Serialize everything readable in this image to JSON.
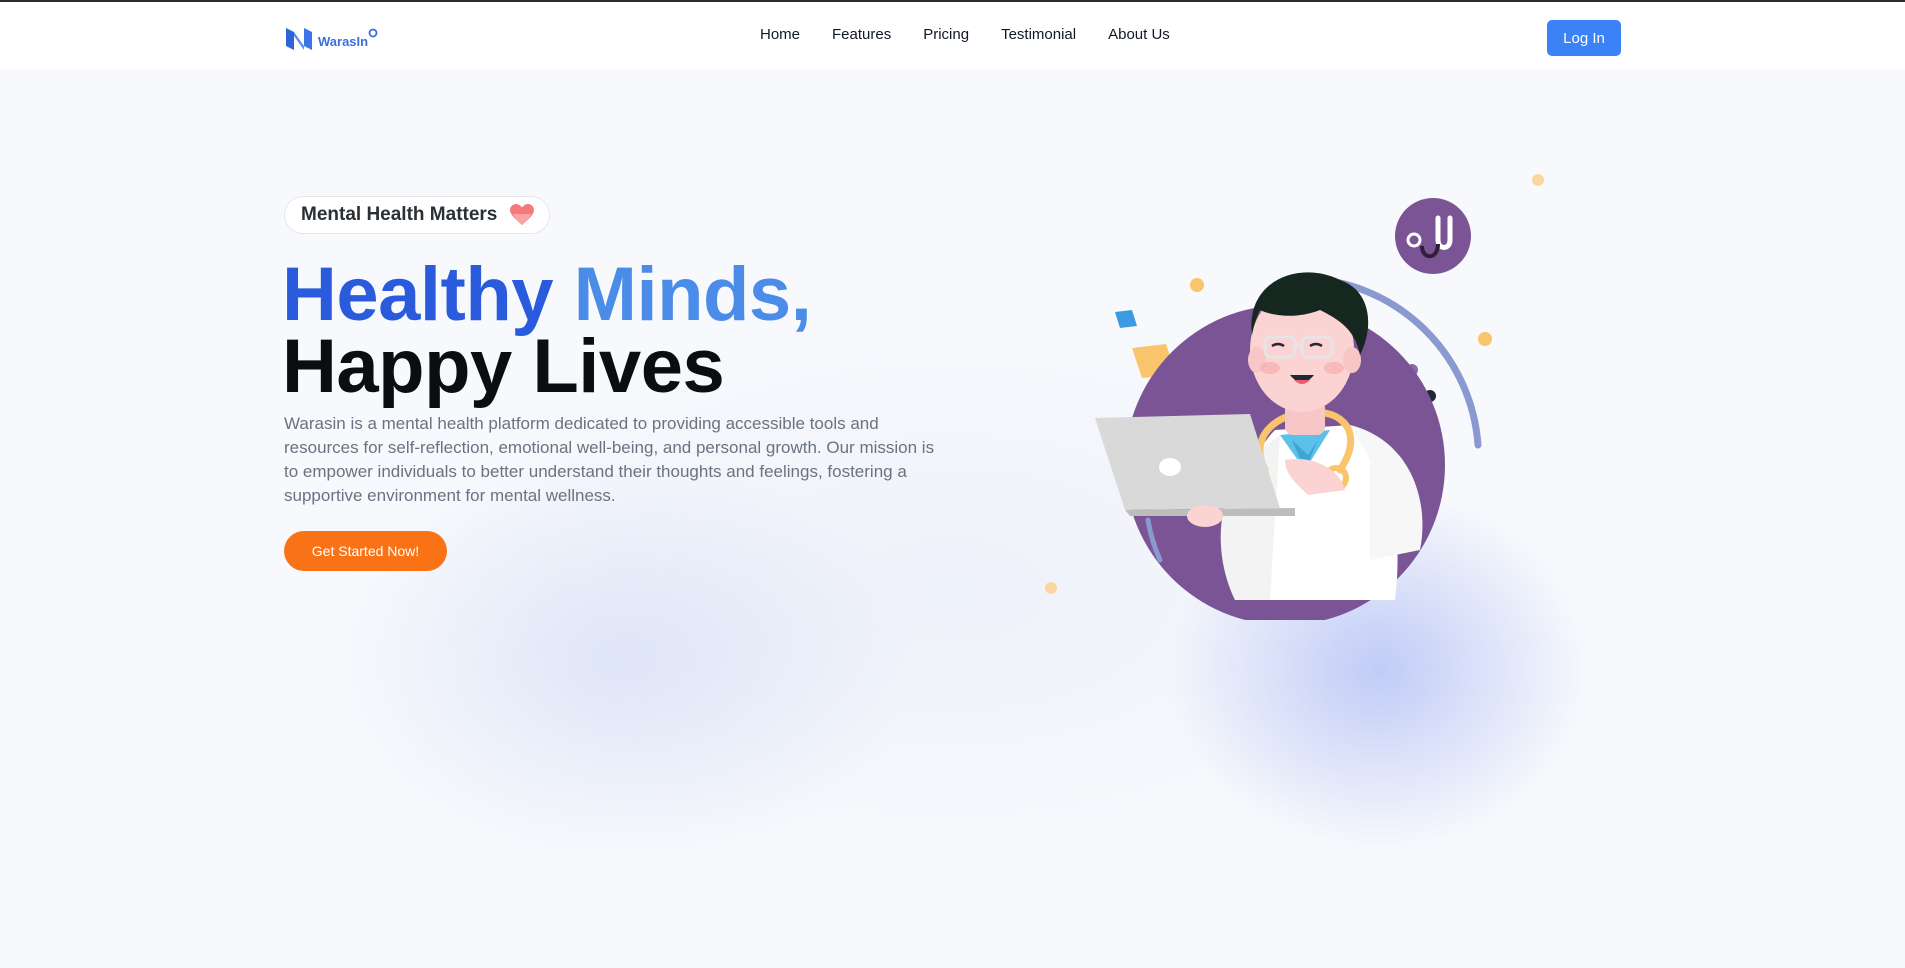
{
  "brand": {
    "name": "WarasIn",
    "primary_color": "#3b82f6",
    "accent_color": "#f97316"
  },
  "nav": {
    "links": [
      {
        "label": "Home"
      },
      {
        "label": "Features"
      },
      {
        "label": "Pricing"
      },
      {
        "label": "Testimonial"
      },
      {
        "label": "About Us"
      }
    ],
    "login_label": "Log In"
  },
  "hero": {
    "badge_text": "Mental Health Matters",
    "badge_icon": "heart-icon",
    "headline_line1_part1": "Healthy ",
    "headline_line1_part2": "Minds,",
    "headline_line2": "Happy Lives",
    "description": "Warasin is a mental health platform dedicated to providing accessible tools and resources for self-reflection, emotional well-being, and personal growth. Our mission is to empower individuals to better understand their thoughts and feelings, fostering a supportive environment for mental wellness.",
    "cta_label": "Get Started Now!",
    "illustration_icon": "doctor-with-laptop-illustration",
    "stethoscope_icon": "stethoscope-icon"
  }
}
